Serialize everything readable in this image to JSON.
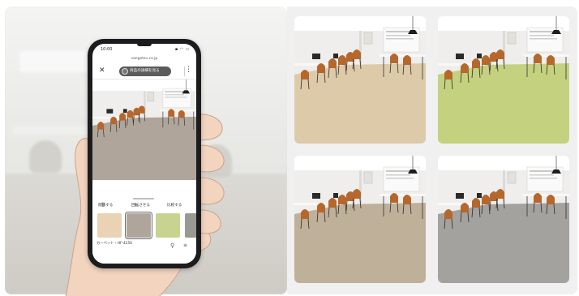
{
  "phone": {
    "time": "10:00",
    "status_icons": "▪ ◠ ▭",
    "url": "sangetsu.co.jp",
    "close_icon": "✕",
    "view_details_label": "商品の詳細を見る",
    "more_icon": "⋮",
    "actions": {
      "delete_label": "削除する",
      "rotate_label": "回転させる",
      "compare_label": "比較する"
    },
    "product_code": "カーペット・HF-4256",
    "swatches": [
      {
        "name": "beige",
        "color": "#e9d3b4"
      },
      {
        "name": "taupe",
        "color": "#b0a59b"
      },
      {
        "name": "green",
        "color": "#c7d38e"
      },
      {
        "name": "gray",
        "color": "#9a9893"
      }
    ]
  },
  "cards": [
    {
      "floor": "#ddcaa9"
    },
    {
      "floor": "#c4d17f"
    },
    {
      "floor": "#bfb09a"
    },
    {
      "floor": "#a3a29f"
    }
  ],
  "icons": {
    "trash": "🗑",
    "rotate": "↻",
    "search": "⚲"
  }
}
